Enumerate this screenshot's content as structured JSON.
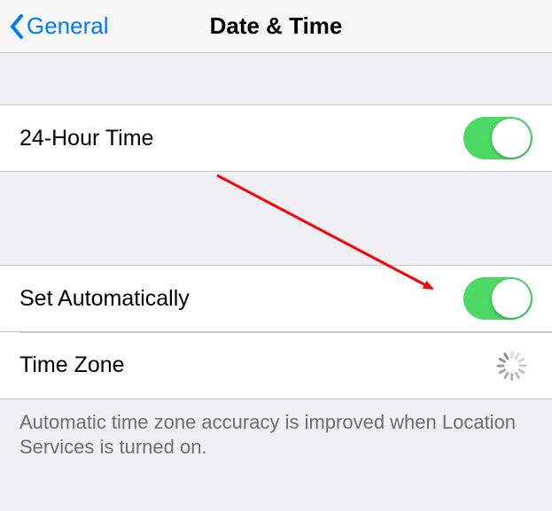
{
  "nav": {
    "back_label": "General",
    "title": "Date & Time"
  },
  "rows": {
    "twenty_four_hour": {
      "label": "24-Hour Time",
      "on": true
    },
    "set_automatically": {
      "label": "Set Automatically",
      "on": true
    },
    "time_zone": {
      "label": "Time Zone"
    }
  },
  "footer": {
    "text": "Automatic time zone accuracy is improved when Location Services is turned on."
  },
  "annotation": {
    "arrow_color": "#ff0000"
  }
}
